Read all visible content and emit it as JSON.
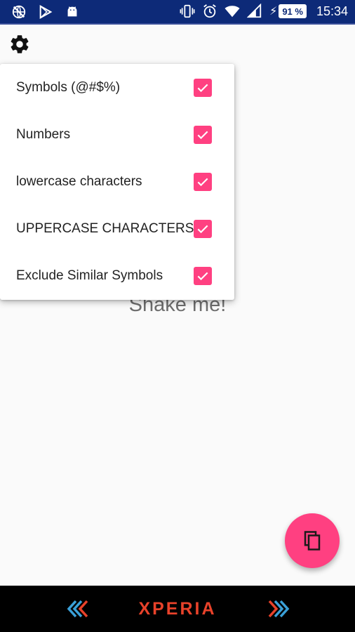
{
  "status_bar": {
    "left_icons": [
      "globe-off-icon",
      "play-store-icon",
      "android-icon"
    ],
    "right_icons": [
      "vibrate-icon",
      "alarm-icon",
      "wifi-icon",
      "signal-icon"
    ],
    "battery": "91 %",
    "time": "15:34"
  },
  "toolbar": {
    "settings_icon": "gear-icon"
  },
  "menu": {
    "items": [
      {
        "label": "Symbols (@#$%)",
        "checked": true
      },
      {
        "label": "Numbers",
        "checked": true
      },
      {
        "label": "lowercase characters",
        "checked": true
      },
      {
        "label": "UPPERCASE CHARACTERS",
        "checked": true
      },
      {
        "label": "Exclude Similar Symbols",
        "checked": true
      }
    ]
  },
  "main": {
    "prompt": "Shake me!"
  },
  "fab": {
    "icon": "copy-icon"
  },
  "nav_bar": {
    "brand": "XPERIA",
    "left_icon": "back-chevrons-icon",
    "right_icon": "forward-chevrons-icon"
  },
  "colors": {
    "accent": "#ff4081",
    "status_bar": "#0d2a78",
    "brand": "#e8422a"
  }
}
